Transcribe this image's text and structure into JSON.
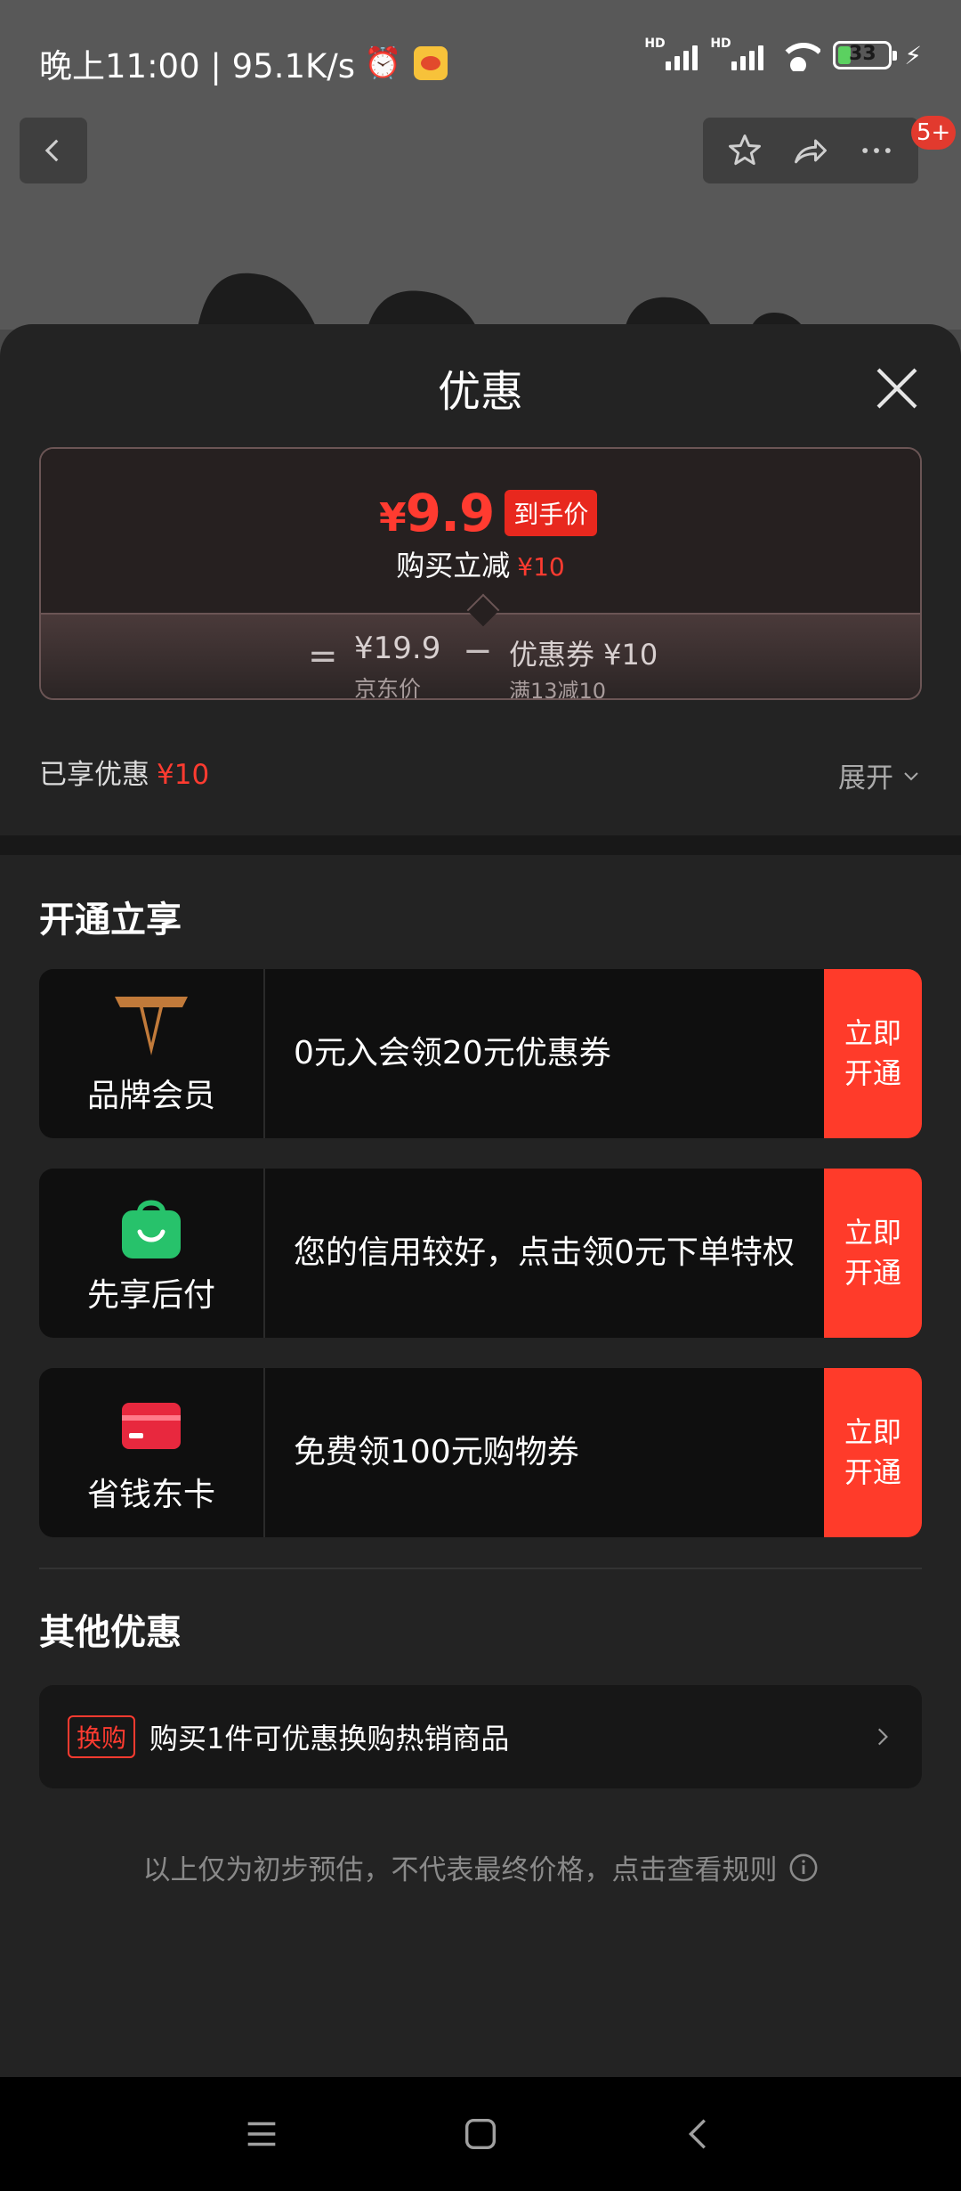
{
  "status_bar": {
    "time_speed": "晚上11:00 | 95.1K/s",
    "signal_label_1": "HD",
    "signal_label_2": "HD",
    "battery_level": "33",
    "battery_percent": 33,
    "battery_color": "#5bd160"
  },
  "top_bar": {
    "back_icon": "chevron-left-icon",
    "favorite_icon": "star-icon",
    "share_icon": "share-icon",
    "more_icon": "more-dots-icon",
    "notification_badge": "5+"
  },
  "sheet": {
    "title": "优惠",
    "close_icon": "close-icon",
    "price_card": {
      "final_price_symbol": "¥",
      "final_price": "9.9",
      "final_price_tag": "到手价",
      "reduce_label": "购买立减",
      "reduce_amount": "¥10",
      "equals": "=",
      "jd_price": "¥19.9",
      "jd_price_label": "京东价",
      "minus": "−",
      "coupon": "优惠券 ¥10",
      "coupon_rule": "满13减10"
    },
    "enjoyed_label": "已享优惠",
    "enjoyed_amount": "¥10",
    "expand_label": "展开",
    "open_section": {
      "title": "开通立享",
      "offers": [
        {
          "name": "品牌会员",
          "icon": "brand-member-v-icon",
          "desc": "0元入会领20元优惠券",
          "button": "立即开通"
        },
        {
          "name": "先享后付",
          "icon": "shopping-bag-icon",
          "desc": "您的信用较好，点击领0元下单特权",
          "button": "立即开通"
        },
        {
          "name": "省钱东卡",
          "icon": "card-icon",
          "desc": "免费领100元购物券",
          "button": "立即开通"
        }
      ]
    },
    "other_section": {
      "title": "其他优惠",
      "swap_tag": "换购",
      "swap_text": "购买1件可优惠换购热销商品"
    },
    "disclaimer": "以上仅为初步预估，不代表最终价格，点击查看规则",
    "accent_color": "#ff3b30"
  },
  "nav_bar": {
    "menu_icon": "menu-icon",
    "home_icon": "home-square-icon",
    "back_icon": "back-triangle-icon"
  }
}
